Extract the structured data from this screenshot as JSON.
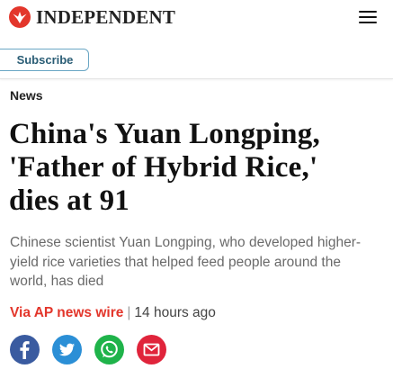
{
  "header": {
    "logo_text": "INDEPENDENT",
    "logo_icon": "eagle-icon",
    "menu_icon": "hamburger-menu-icon",
    "subscribe_label": "Subscribe"
  },
  "article": {
    "section": "News",
    "headline_lines": [
      "China's Yuan Longping,",
      "'Father of Hybrid Rice,'",
      "dies at 91"
    ],
    "standfirst": "Chinese scientist Yuan Longping, who developed higher-yield rice varieties that helped feed people around the world, has died",
    "source": "Via AP news wire",
    "separator": "|",
    "time_ago": "14 hours ago"
  },
  "share": [
    {
      "name": "facebook",
      "icon": "facebook-icon",
      "color": "#3a5ba0"
    },
    {
      "name": "twitter",
      "icon": "twitter-icon",
      "color": "#2b8fd6"
    },
    {
      "name": "whatsapp",
      "icon": "whatsapp-icon",
      "color": "#1fb34a"
    },
    {
      "name": "email",
      "icon": "email-icon",
      "color": "#e0243b"
    }
  ],
  "colors": {
    "brand_red": "#e3362b",
    "subscribe_border": "#6aa6c4",
    "subscribe_text": "#2a5d75",
    "headline": "#111111",
    "standfirst": "#6a6a6a"
  }
}
